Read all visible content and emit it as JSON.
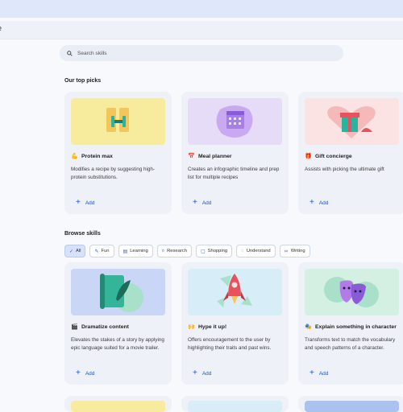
{
  "header": {
    "subbar_text": "e"
  },
  "search": {
    "placeholder": "Search skills"
  },
  "top_picks": {
    "title": "Our top picks",
    "cards": [
      {
        "emoji": "💪",
        "title": "Protein max",
        "desc": "Modifies a recipe by suggesting high-protein substitutions.",
        "add": "Add"
      },
      {
        "emoji": "📅",
        "title": "Meal planner",
        "desc": "Creates an infographic timeline and prep list for multiple recipes",
        "add": "Add"
      },
      {
        "emoji": "🎁",
        "title": "Gift concierge",
        "desc": "Assists with picking the ultimate gift",
        "add": "Add"
      }
    ]
  },
  "browse": {
    "title": "Browse skills",
    "chips": [
      "All",
      "Fun",
      "Learning",
      "Research",
      "Shopping",
      "Understand",
      "Writing"
    ],
    "cards": [
      {
        "emoji": "🎬",
        "title": "Dramatize content",
        "desc": "Elevates the stakes of a story by applying epic language suited for a movie trailer.",
        "add": "Add"
      },
      {
        "emoji": "🙌",
        "title": "Hype it up!",
        "desc": "Offers encouragement to the user by highlighting their traits and past wins.",
        "add": "Add"
      },
      {
        "emoji": "🎭",
        "title": "Explain something in character",
        "desc": "Transforms text to match the vocabulary and speech patterns of a character.",
        "add": "Add"
      }
    ]
  },
  "colors": {
    "accent": "#1a57c7",
    "topbar": "#dfe7fb",
    "card_bg": "#eef1f8"
  }
}
